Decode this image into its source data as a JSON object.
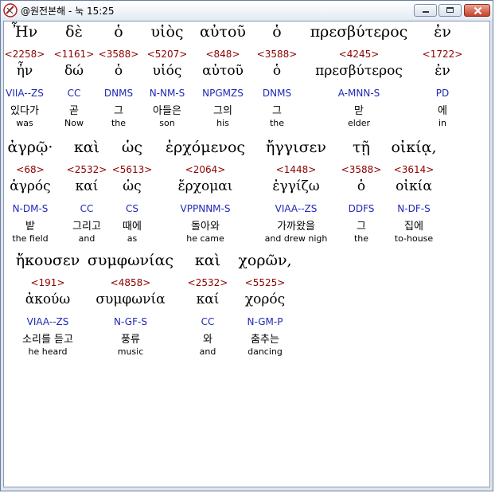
{
  "window": {
    "title": "@원전본해 - 눅 15:25",
    "minimize_label": "Minimize",
    "maximize_label": "Maximize",
    "close_label": "Close"
  },
  "verse_reference": "눅 15:25",
  "lines": [
    {
      "words": [
        {
          "greek": "Ἦν",
          "strongs": "<2258>",
          "lexeme": "ἦν",
          "parsing": "VIIA--ZS",
          "korean": "있다가",
          "english": "was",
          "selected": true
        },
        {
          "greek": "δὲ",
          "strongs": "<1161>",
          "lexeme": "δώ",
          "parsing": "CC",
          "korean": "곧",
          "english": "Now"
        },
        {
          "greek": "ὁ",
          "strongs": "<3588>",
          "lexeme": "ὁ",
          "parsing": "DNMS",
          "korean": "그",
          "english": "the"
        },
        {
          "greek": "υἱὸς",
          "strongs": "<5207>",
          "lexeme": "υἱός",
          "parsing": "N-NM-S",
          "korean": "아들은",
          "english": "son"
        },
        {
          "greek": "αὐτοῦ",
          "strongs": "<848>",
          "lexeme": "αὐτοῦ",
          "parsing": "NPGMZS",
          "korean": "그의",
          "english": "his"
        },
        {
          "greek": "ὁ",
          "strongs": "<3588>",
          "lexeme": "ὁ",
          "parsing": "DNMS",
          "korean": "그",
          "english": "the"
        },
        {
          "greek": "πρεσβύτερος",
          "strongs": "<4245>",
          "lexeme": "πρεσβύτερος",
          "parsing": "A-MNN-S",
          "korean": "맏",
          "english": "elder"
        },
        {
          "greek": "ἐν",
          "strongs": "<1722>",
          "lexeme": "ἐν",
          "parsing": "PD",
          "korean": "에",
          "english": "in"
        }
      ]
    },
    {
      "words": [
        {
          "greek": "ἀγρῷ·",
          "strongs": "<68>",
          "lexeme": "ἀγρός",
          "parsing": "N-DM-S",
          "korean": "밭",
          "english": "the field"
        },
        {
          "greek": "καὶ",
          "strongs": "<2532>",
          "lexeme": "καί",
          "parsing": "CC",
          "korean": "그리고",
          "english": "and"
        },
        {
          "greek": "ὡς",
          "strongs": "<5613>",
          "lexeme": "ὡς",
          "parsing": "CS",
          "korean": "때에",
          "english": "as"
        },
        {
          "greek": "ἐρχόμενος",
          "strongs": "<2064>",
          "lexeme": "ἔρχομαι",
          "parsing": "VPPNNM-S",
          "korean": "돌아와",
          "english": "he came"
        },
        {
          "greek": "ἤγγισεν",
          "strongs": "<1448>",
          "lexeme": "ἐγγίζω",
          "parsing": "VIAA--ZS",
          "korean": "가까왔을",
          "english": "and drew nigh"
        },
        {
          "greek": "τῇ",
          "strongs": "<3588>",
          "lexeme": "ὁ",
          "parsing": "DDFS",
          "korean": "그",
          "english": "the"
        },
        {
          "greek": "οἰκίᾳ,",
          "strongs": "<3614>",
          "lexeme": "οἰκία",
          "parsing": "N-DF-S",
          "korean": "집에",
          "english": "to-house"
        }
      ]
    },
    {
      "words": [
        {
          "greek": "ἤκουσεν",
          "strongs": "<191>",
          "lexeme": "ἀκούω",
          "parsing": "VIAA--ZS",
          "korean": "소리를 듣고",
          "english": "he heard"
        },
        {
          "greek": "συμφωνίας",
          "strongs": "<4858>",
          "lexeme": "συμφωνία",
          "parsing": "N-GF-S",
          "korean": "풍류",
          "english": "music"
        },
        {
          "greek": "καὶ",
          "strongs": "<2532>",
          "lexeme": "καί",
          "parsing": "CC",
          "korean": "와",
          "english": "and"
        },
        {
          "greek": "χορῶν,",
          "strongs": "<5525>",
          "lexeme": "χορός",
          "parsing": "N-GM-P",
          "korean": "춤추는",
          "english": "dancing"
        }
      ]
    }
  ]
}
